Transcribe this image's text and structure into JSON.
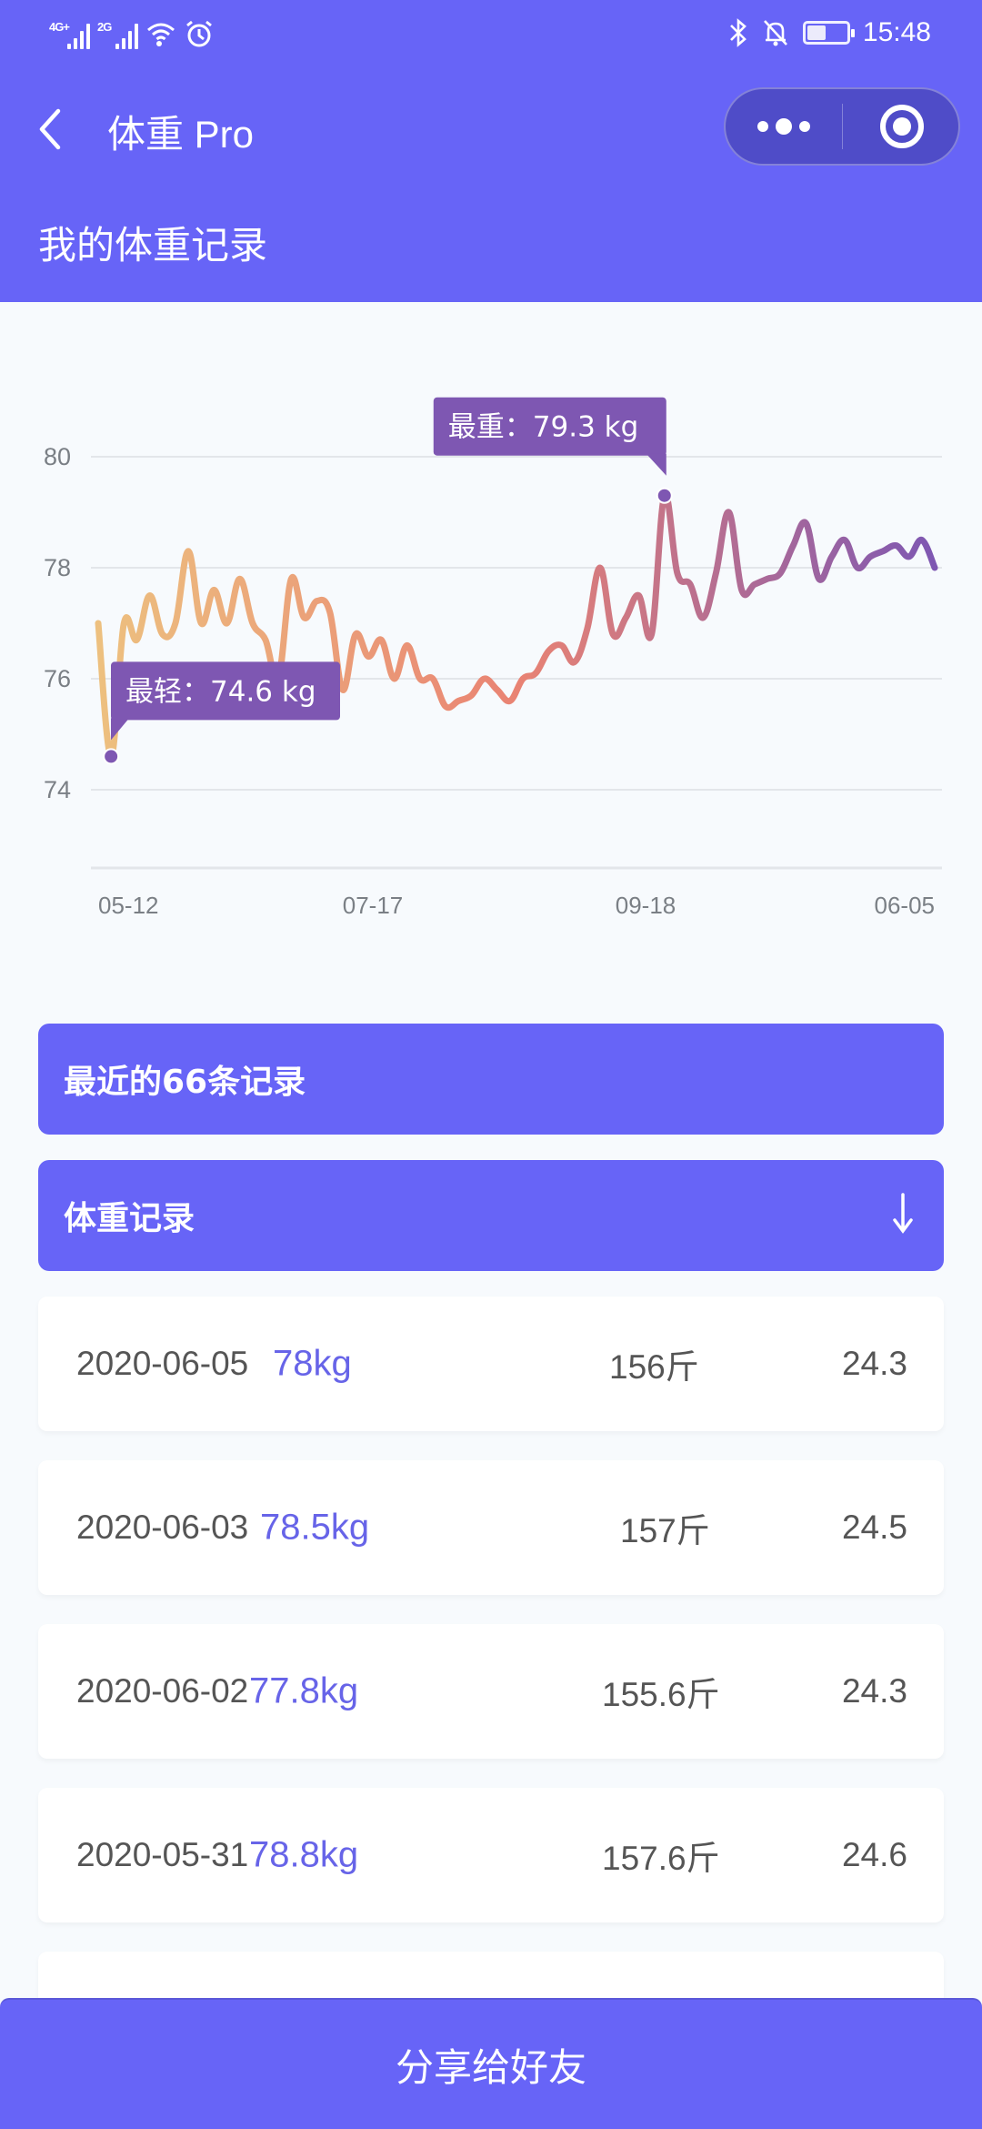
{
  "status_bar": {
    "network1": "4G+",
    "network2": "2G",
    "time": "15:48",
    "battery_level": 0.45,
    "icons": [
      "signal-4g-icon",
      "signal-2g-icon",
      "wifi-icon",
      "alarm-icon",
      "bluetooth-icon",
      "mute-bell-icon",
      "battery-icon"
    ]
  },
  "nav": {
    "title": "体重 Pro",
    "back_icon": "chevron-left-icon",
    "more_icon": "more-dots-icon",
    "close_icon": "target-circle-icon"
  },
  "page": {
    "heading": "我的体重记录"
  },
  "colors": {
    "brand": "#6764f7",
    "capsule": "#4f4cc8",
    "tooltip": "#7e57b2",
    "line_start": "#edc07f",
    "line_mid": "#e98373",
    "line_end": "#7e57b2",
    "kg_text": "#6764e8"
  },
  "chart_data": {
    "type": "line",
    "title": "",
    "xlabel": "",
    "ylabel": "",
    "ylim": [
      74,
      80
    ],
    "yticks": [
      80,
      78,
      76,
      74
    ],
    "ytick_labels": [
      "80",
      "78",
      "76",
      "74"
    ],
    "xtick_labels": [
      "05-12",
      "07-17",
      "09-18",
      "06-05"
    ],
    "grid": true,
    "legend": "none",
    "series": [
      {
        "name": "体重",
        "unit": "kg",
        "values": [
          77.0,
          74.6,
          77.0,
          76.7,
          77.5,
          76.8,
          77.0,
          78.3,
          77.0,
          77.6,
          77.0,
          77.8,
          77.0,
          76.7,
          76.0,
          77.8,
          77.1,
          77.4,
          77.2,
          75.8,
          76.8,
          76.4,
          76.7,
          76.0,
          76.6,
          76.0,
          76.0,
          75.5,
          75.6,
          75.7,
          76.0,
          75.8,
          75.6,
          76.0,
          76.1,
          76.5,
          76.6,
          76.3,
          76.9,
          78.0,
          76.8,
          77.1,
          77.5,
          76.8,
          79.3,
          77.9,
          77.7,
          77.1,
          77.9,
          79.0,
          77.6,
          77.7,
          77.8,
          77.9,
          78.4,
          78.8,
          77.8,
          78.2,
          78.5,
          78.0,
          78.2,
          78.3,
          78.4,
          78.2,
          78.5,
          78.0
        ]
      }
    ],
    "annotations": [
      {
        "label": "最轻：74.6 kg",
        "kind": "min",
        "value": 74.6,
        "index": 1
      },
      {
        "label": "最重：79.3 kg",
        "kind": "max",
        "value": 79.3,
        "index": 44
      }
    ]
  },
  "sections": {
    "recent_label": "最近的66条记录",
    "records_label": "体重记录",
    "records_icon": "arrow-down-icon"
  },
  "records": [
    {
      "date": "2020-06-05",
      "kg": "78kg",
      "jin": "156斤",
      "bmi": "24.3"
    },
    {
      "date": "2020-06-03",
      "kg": "78.5kg",
      "jin": "157斤",
      "bmi": "24.5"
    },
    {
      "date": "2020-06-02",
      "kg": "77.8kg",
      "jin": "155.6斤",
      "bmi": "24.3"
    },
    {
      "date": "2020-05-31",
      "kg": "78.8kg",
      "jin": "157.6斤",
      "bmi": "24.6"
    },
    {
      "date": "",
      "kg": "",
      "jin": "",
      "bmi": ""
    }
  ],
  "footer": {
    "share_label": "分享给好友"
  }
}
